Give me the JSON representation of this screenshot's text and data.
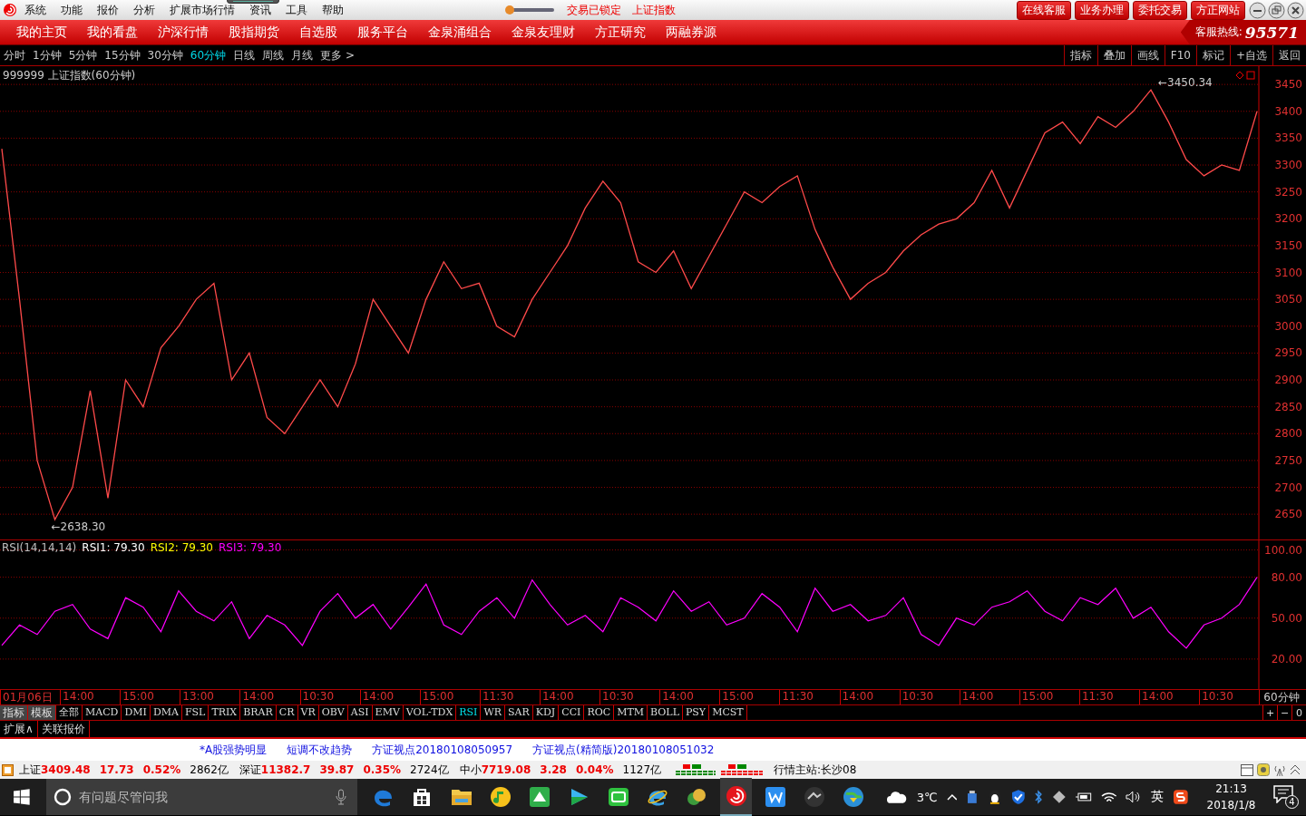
{
  "menu_bar": {
    "items": [
      "系统",
      "功能",
      "报价",
      "分析",
      "扩展市场行情",
      "资讯",
      "工具",
      "帮助"
    ],
    "status_texts": [
      "交易已锁定",
      "上证指数"
    ],
    "buttons": [
      "在线客服",
      "业务办理",
      "委托交易",
      "方正网站"
    ]
  },
  "nav_bar": {
    "items": [
      "我的主页",
      "我的看盘",
      "沪深行情",
      "股指期货",
      "自选股",
      "服务平台",
      "金泉涌组合",
      "金泉友理财",
      "方正研究",
      "两融券源"
    ],
    "hotline_label": "客服热线:",
    "hotline_number": "95571"
  },
  "period_tabs": [
    {
      "label": "分时",
      "selected": false
    },
    {
      "label": "1分钟",
      "selected": false
    },
    {
      "label": "5分钟",
      "selected": false
    },
    {
      "label": "15分钟",
      "selected": false
    },
    {
      "label": "30分钟",
      "selected": false
    },
    {
      "label": "60分钟",
      "selected": true
    },
    {
      "label": "日线",
      "selected": false
    },
    {
      "label": "周线",
      "selected": false
    },
    {
      "label": "月线",
      "selected": false
    },
    {
      "label": "更多 >",
      "selected": false
    }
  ],
  "chart_tools": [
    "指标",
    "叠加",
    "画线",
    "F10",
    "标记",
    "+自选",
    "返回"
  ],
  "price_chart": {
    "title": "999999 上证指数(60分钟)",
    "chart_data": {
      "type": "line",
      "ylim": [
        2603,
        3484
      ],
      "yticks": [
        2650,
        2700,
        2750,
        2800,
        2850,
        2900,
        2950,
        3000,
        3050,
        3100,
        3150,
        3200,
        3250,
        3300,
        3350,
        3400,
        3450
      ],
      "values": [
        3330,
        3050,
        2750,
        2640,
        2700,
        2880,
        2680,
        2900,
        2850,
        2960,
        3000,
        3050,
        3080,
        2900,
        2950,
        2830,
        2800,
        2850,
        2900,
        2850,
        2930,
        3050,
        3000,
        2950,
        3050,
        3120,
        3070,
        3080,
        3000,
        2980,
        3050,
        3100,
        3150,
        3220,
        3270,
        3230,
        3120,
        3100,
        3140,
        3070,
        3130,
        3190,
        3250,
        3230,
        3260,
        3280,
        3180,
        3110,
        3050,
        3080,
        3100,
        3140,
        3170,
        3190,
        3200,
        3230,
        3290,
        3220,
        3290,
        3360,
        3380,
        3340,
        3390,
        3370,
        3400,
        3440,
        3380,
        3310,
        3280,
        3300,
        3290,
        3400
      ],
      "grid": true
    },
    "high_label": "←3450.34",
    "low_label": "←2638.30"
  },
  "rsi_panel": {
    "legend": [
      {
        "text": "RSI(14,14,14)",
        "color": "#c0c0c0"
      },
      {
        "text": "RSI1: 79.30",
        "color": "#ffffff"
      },
      {
        "text": "RSI2: 79.30",
        "color": "#ffff00"
      },
      {
        "text": "RSI3: 79.30",
        "color": "#ff00ff"
      }
    ],
    "chart_data": {
      "type": "line",
      "grid": true,
      "ylim": [
        -2,
        107
      ],
      "yticks": [
        {
          "value": 100,
          "label": "100.00"
        },
        {
          "value": 80,
          "label": "80.00"
        },
        {
          "value": 50,
          "label": "50.00"
        },
        {
          "value": 20,
          "label": "20.00"
        }
      ],
      "values": [
        30,
        45,
        38,
        55,
        60,
        42,
        35,
        65,
        58,
        40,
        70,
        55,
        48,
        62,
        35,
        52,
        45,
        30,
        55,
        68,
        50,
        60,
        42,
        58,
        75,
        45,
        38,
        55,
        65,
        50,
        78,
        60,
        45,
        52,
        40,
        65,
        58,
        48,
        70,
        55,
        62,
        45,
        50,
        68,
        58,
        40,
        72,
        55,
        60,
        48,
        52,
        65,
        38,
        30,
        50,
        45,
        58,
        62,
        70,
        55,
        48,
        65,
        60,
        72,
        50,
        58,
        40,
        28,
        45,
        50,
        60,
        80
      ]
    }
  },
  "time_axis": {
    "labels": [
      "01月06日",
      "14:00",
      "15:00",
      "13:00",
      "14:00",
      "10:30",
      "14:00",
      "15:00",
      "11:30",
      "14:00",
      "10:30",
      "14:00",
      "15:00",
      "11:30",
      "14:00",
      "10:30",
      "14:00",
      "15:00",
      "11:30",
      "14:00",
      "10:30"
    ],
    "period": "60分钟"
  },
  "indicator_tabs": [
    {
      "label": "指标",
      "kind": "menu",
      "selected": false
    },
    {
      "label": "模板",
      "kind": "menu",
      "selected": false
    },
    {
      "label": "全部",
      "kind": "indicator",
      "selected": false
    },
    {
      "label": "MACD",
      "kind": "indicator",
      "selected": false
    },
    {
      "label": "DMI",
      "kind": "indicator",
      "selected": false
    },
    {
      "label": "DMA",
      "kind": "indicator",
      "selected": false
    },
    {
      "label": "FSL",
      "kind": "indicator",
      "selected": false
    },
    {
      "label": "TRIX",
      "kind": "indicator",
      "selected": false
    },
    {
      "label": "BRAR",
      "kind": "indicator",
      "selected": false
    },
    {
      "label": "CR",
      "kind": "indicator",
      "selected": false
    },
    {
      "label": "VR",
      "kind": "indicator",
      "selected": false
    },
    {
      "label": "OBV",
      "kind": "indicator",
      "selected": false
    },
    {
      "label": "ASI",
      "kind": "indicator",
      "selected": false
    },
    {
      "label": "EMV",
      "kind": "indicator",
      "selected": false
    },
    {
      "label": "VOL-TDX",
      "kind": "indicator",
      "selected": false
    },
    {
      "label": "RSI",
      "kind": "indicator",
      "selected": true
    },
    {
      "label": "WR",
      "kind": "indicator",
      "selected": false
    },
    {
      "label": "SAR",
      "kind": "indicator",
      "selected": false
    },
    {
      "label": "KDJ",
      "kind": "indicator",
      "selected": false
    },
    {
      "label": "CCI",
      "kind": "indicator",
      "selected": false
    },
    {
      "label": "ROC",
      "kind": "indicator",
      "selected": false
    },
    {
      "label": "MTM",
      "kind": "indicator",
      "selected": false
    },
    {
      "label": "BOLL",
      "kind": "indicator",
      "selected": false
    },
    {
      "label": "PSY",
      "kind": "indicator",
      "selected": false
    },
    {
      "label": "MCST",
      "kind": "indicator",
      "selected": false
    }
  ],
  "zoom_buttons": [
    "+",
    "−",
    "0"
  ],
  "extra_tabs": [
    "扩展∧",
    "关联报价"
  ],
  "news": [
    "*A股强势明显",
    "短调不改趋势",
    "方证视点20180108050957",
    "方证视点(精简版)20180108051032"
  ],
  "market_status": {
    "indices": [
      {
        "name": "上证",
        "price": "3409.48",
        "change": "17.73",
        "percent": "0.52%",
        "volume": "2862亿"
      },
      {
        "name": "深证",
        "price": "11382.7",
        "change": "39.87",
        "percent": "0.35%",
        "volume": "2724亿"
      },
      {
        "name": "中小",
        "price": "7719.08",
        "change": "3.28",
        "percent": "0.04%",
        "volume": "1127亿"
      }
    ],
    "server": "行情主站:长沙08"
  },
  "taskbar": {
    "search_placeholder": "有问题尽管问我",
    "apps": [
      {
        "kind": "edge",
        "selected": false
      },
      {
        "kind": "store",
        "selected": false
      },
      {
        "kind": "folder",
        "selected": false
      },
      {
        "kind": "music",
        "selected": false
      },
      {
        "kind": "green",
        "selected": false
      },
      {
        "kind": "video",
        "selected": false
      },
      {
        "kind": "tv",
        "selected": false
      },
      {
        "kind": "ie",
        "selected": false
      },
      {
        "kind": "trader",
        "selected": false
      },
      {
        "kind": "spiral",
        "selected": true
      },
      {
        "kind": "wps",
        "selected": false
      },
      {
        "kind": "dark",
        "selected": false
      },
      {
        "kind": "globe",
        "selected": false
      }
    ],
    "weather": "3℃",
    "ime": "英",
    "time": "21:13",
    "date": "2018/1/8",
    "notifications": "4"
  }
}
